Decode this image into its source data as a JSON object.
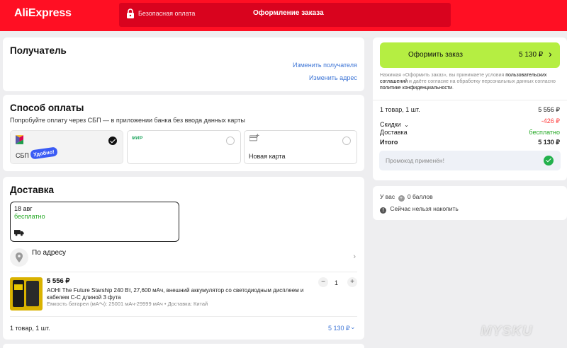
{
  "header": {
    "logo": "AliExpress",
    "secure_text": "Безопасная оплата",
    "checkout_title": "Оформление заказа"
  },
  "recipient": {
    "title": "Получатель",
    "change_recipient": "Изменить получателя",
    "change_address": "Изменить адрес"
  },
  "payment": {
    "title": "Способ оплаты",
    "hint": "Попробуйте оплату через СБП — в приложении банка без ввода данных карты",
    "options": [
      {
        "label": "СБП",
        "badge": "Удобно!",
        "selected": true
      },
      {
        "label": "",
        "brand": "МИР",
        "selected": false
      },
      {
        "label": "Новая карта",
        "selected": false
      }
    ]
  },
  "delivery": {
    "title": "Доставка",
    "date": "18 авг",
    "price": "бесплатно",
    "address_label": "По адресу",
    "product": {
      "price": "5 556 ₽",
      "name": "AOHI The Future Starship 240 Вт, 27,600 мАч, внешний аккумулятор со светодиодным дисплеем и кабелем C-C длиной 3 фута",
      "meta": "Емкость батареи (мА*ч): 25001 мАч-29999 мАч • Доставка: Китай",
      "quantity": "1"
    },
    "footer_count": "1 товар, 1 шт.",
    "footer_total": "5 130 ₽"
  },
  "summary": {
    "order_button": "Оформить заказ",
    "order_total": "5 130 ₽",
    "legal_1": "Нажимая «Оформить заказ», вы принимаете условия ",
    "legal_link_1": "пользовательских соглашений",
    "legal_2": " и даёте согласие на обработку персональных данных согласно ",
    "legal_link_2": "политике конфиденциальности",
    "legal_3": ".",
    "items_label": "1 товар, 1 шт.",
    "items_value": "5 556 ₽",
    "discounts_label": "Скидки",
    "discounts_value": "-426 ₽",
    "delivery_label": "Доставка",
    "delivery_value": "бесплатно",
    "total_label": "Итого",
    "total_value": "5 130 ₽",
    "promo_text": "Промокод применён!"
  },
  "points": {
    "balance_prefix": "У вас",
    "balance_value": "0 баллов",
    "accrual_text": "Сейчас нельзя накопить"
  },
  "watermark": "MYSKU",
  "colors": {
    "brand_red": "#ff0f23",
    "order_button": "#b5ee42",
    "link": "#3d75d6",
    "free_green": "#23a823",
    "discount_red": "#ff3b3b"
  }
}
